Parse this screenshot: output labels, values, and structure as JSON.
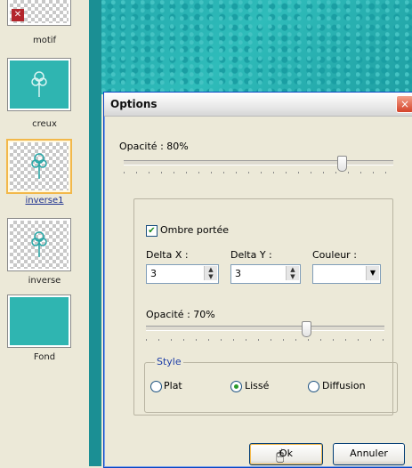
{
  "layers": [
    {
      "label": "motif",
      "selected": false
    },
    {
      "label": "creux",
      "selected": false
    },
    {
      "label": "inverse1",
      "selected": true
    },
    {
      "label": "inverse",
      "selected": false
    },
    {
      "label": "Fond",
      "selected": false
    }
  ],
  "dialog": {
    "title": "Options",
    "close_icon": "×",
    "opacity_label": "Opacité : 80%",
    "opacity_value": 80,
    "shadow": {
      "checkbox_label": "Ombre portée",
      "checked": true,
      "delta_x_label": "Delta X :",
      "delta_x_value": "3",
      "delta_y_label": "Delta Y :",
      "delta_y_value": "3",
      "color_label": "Couleur :",
      "opacity_label": "Opacité : 70%",
      "opacity_value": 70
    },
    "style": {
      "legend": "Style",
      "options": [
        "Plat",
        "Lissé",
        "Diffusion"
      ],
      "selected": "Lissé"
    },
    "ok_label": "Ok",
    "cancel_label": "Annuler"
  },
  "colors": {
    "accent_teal": "#2fb5b1",
    "title_blue": "#0b47c4"
  }
}
